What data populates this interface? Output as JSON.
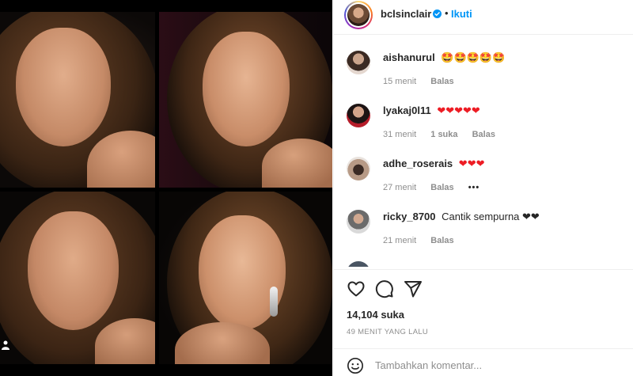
{
  "post": {
    "username": "bclsinclair",
    "follow_label": "Ikuti",
    "separator": "•",
    "likes": "14,104 suka",
    "time": "49 MENIT YANG LALU"
  },
  "comments": [
    {
      "user": "aishanurul",
      "text": "🤩🤩🤩🤩🤩",
      "time": "15 menit",
      "likes": "",
      "reply": "Balas",
      "more": ""
    },
    {
      "user": "lyakaj0l11",
      "text": "❤❤❤❤❤",
      "time": "31 menit",
      "likes": "1 suka",
      "reply": "Balas",
      "more": ""
    },
    {
      "user": "adhe_roserais",
      "text": "❤❤❤",
      "time": "27 menit",
      "likes": "",
      "reply": "Balas",
      "more": "•••"
    },
    {
      "user": "ricky_8700",
      "text": "Cantik sempurna ❤❤",
      "time": "21 menit",
      "likes": "",
      "reply": "Balas",
      "more": ""
    }
  ],
  "add_comment": {
    "placeholder": "Tambahkan komentar..."
  },
  "icons": {
    "verified": "verified-badge-icon",
    "like": "heart-icon",
    "comment": "comment-bubble-icon",
    "share": "paper-plane-icon",
    "emoji": "smiley-icon"
  },
  "colors": {
    "accent": "#0095f6",
    "heart": "#ed1c24",
    "muted": "#8e8e8e"
  }
}
